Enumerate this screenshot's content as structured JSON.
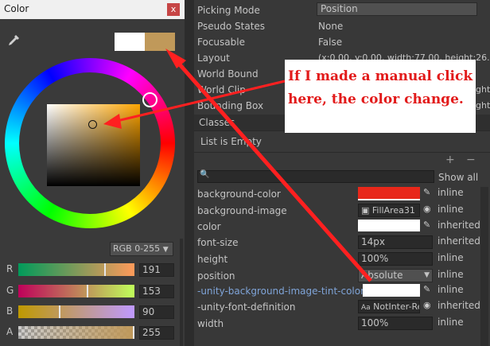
{
  "picker": {
    "title": "Color",
    "close_glyph": "x",
    "eyedropper_icon": "eyedropper-icon",
    "previous_color": "#ffffff",
    "current_color": "#c0995a",
    "mode": "RGB 0-255",
    "channels": [
      {
        "label": "R",
        "value": "191",
        "level": 0.749
      },
      {
        "label": "G",
        "value": "153",
        "level": 0.6
      },
      {
        "label": "B",
        "value": "90",
        "level": 0.353
      },
      {
        "label": "A",
        "value": "255",
        "level": 1.0
      }
    ]
  },
  "inspector": {
    "props": [
      {
        "label": "Picking Mode",
        "value": "Position"
      },
      {
        "label": "Pseudo States",
        "value": "None"
      },
      {
        "label": "Focusable",
        "value": "False"
      },
      {
        "label": "Layout",
        "value": "(x:0.00, y:0.00, width:77.00, height:26."
      },
      {
        "label": "World Bound",
        "value": ""
      },
      {
        "label": "World Clip",
        "value": "ght:"
      },
      {
        "label": "Bounding Box",
        "value": "ght:"
      }
    ],
    "classes_label": "Classes",
    "list_empty": "List is Empty",
    "add_label": "+",
    "remove_label": "−",
    "search_icon": "search-icon",
    "show_all": "Show all",
    "styles": {
      "background_color": {
        "label": "background-color",
        "color": "#e8271a",
        "flag": "inline"
      },
      "background_image": {
        "label": "background-image",
        "value": "FillArea31",
        "flag": "inline"
      },
      "color": {
        "label": "color",
        "color": "#ffffff",
        "flag": "inherited"
      },
      "font_size": {
        "label": "font-size",
        "value": "14px",
        "flag": "inherited"
      },
      "height": {
        "label": "height",
        "value": "100%",
        "flag": "inline"
      },
      "position": {
        "label": "position",
        "value": "Absolute",
        "flag": "inline"
      },
      "tint": {
        "label": "-unity-background-image-tint-color",
        "color": "#ffffff",
        "flag": "inline"
      },
      "font_def": {
        "label": "-unity-font-definition",
        "value": "NotInter-Re",
        "flag": "inherited"
      },
      "width": {
        "label": "width",
        "value": "100%",
        "flag": "inline"
      }
    }
  },
  "annotation": {
    "text": "If I made a manual click here, the color change.",
    "color": "#e21a1a"
  }
}
